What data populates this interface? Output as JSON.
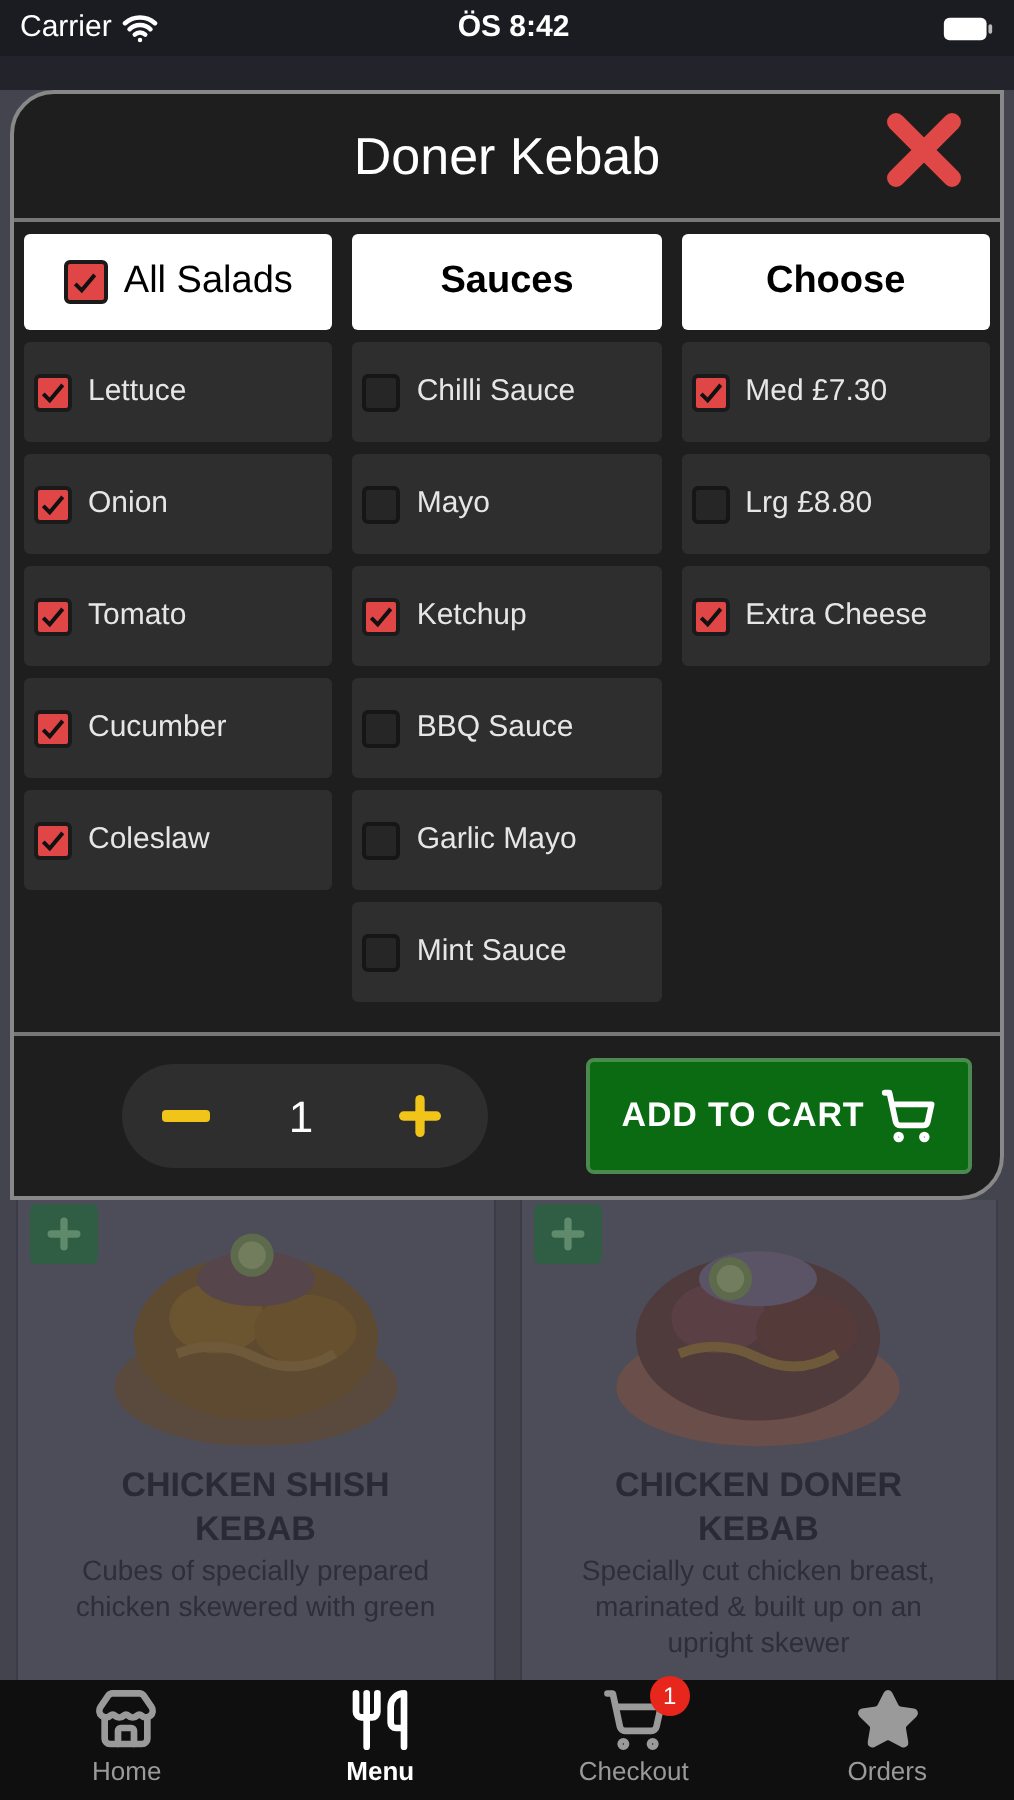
{
  "status_bar": {
    "carrier": "Carrier",
    "time": "ÖS 8:42"
  },
  "modal": {
    "title": "Doner Kebab",
    "columns": [
      {
        "header": {
          "kind": "checkbox",
          "label": "All Salads",
          "checked": true
        },
        "items": [
          {
            "label": "Lettuce",
            "checked": true
          },
          {
            "label": "Onion",
            "checked": true
          },
          {
            "label": "Tomato",
            "checked": true
          },
          {
            "label": "Cucumber",
            "checked": true
          },
          {
            "label": "Coleslaw",
            "checked": true
          }
        ]
      },
      {
        "header": {
          "kind": "label",
          "label": "Sauces"
        },
        "items": [
          {
            "label": "Chilli Sauce",
            "checked": false
          },
          {
            "label": "Mayo",
            "checked": false
          },
          {
            "label": "Ketchup",
            "checked": true
          },
          {
            "label": "BBQ Sauce",
            "checked": false
          },
          {
            "label": "Garlic Mayo",
            "checked": false
          },
          {
            "label": "Mint Sauce",
            "checked": false
          }
        ]
      },
      {
        "header": {
          "kind": "label",
          "label": "Choose"
        },
        "items": [
          {
            "label": "Med £7.30",
            "checked": true
          },
          {
            "label": "Lrg £8.80",
            "checked": false
          },
          {
            "label": "Extra Cheese",
            "checked": true
          }
        ]
      }
    ],
    "quantity": "1",
    "add_to_cart": "ADD TO CART"
  },
  "cards": [
    {
      "title": "CHICKEN SHISH KEBAB",
      "description": "Cubes of specially prepared chicken skewered with green"
    },
    {
      "title": "CHICKEN DONER KEBAB",
      "description": "Specially cut chicken breast, marinated & built up on an upright skewer"
    }
  ],
  "tab_bar": [
    {
      "kind": "home",
      "label": "Home",
      "selected": false
    },
    {
      "kind": "menu",
      "label": "Menu",
      "selected": true
    },
    {
      "kind": "checkout",
      "label": "Checkout",
      "selected": false,
      "badge": "1"
    },
    {
      "kind": "orders",
      "label": "Orders",
      "selected": false
    }
  ]
}
